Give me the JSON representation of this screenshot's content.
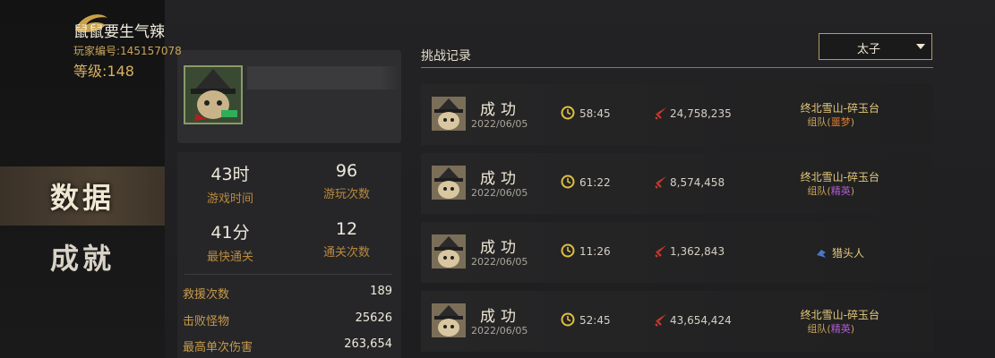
{
  "sidebar": {
    "items": [
      {
        "label": "数据",
        "active": true
      },
      {
        "label": "成就",
        "active": false
      }
    ]
  },
  "player": {
    "name": "鼠鼠要生气辣",
    "id_text": "玩家编号:145157078",
    "level_text": "等级:148"
  },
  "stats": {
    "big": [
      {
        "value": "43时",
        "label": "游戏时间"
      },
      {
        "value": "96",
        "label": "游玩次数"
      },
      {
        "value": "41分",
        "label": "最快通关"
      },
      {
        "value": "12",
        "label": "通关次数"
      }
    ],
    "rows": [
      {
        "label": "救援次数",
        "value": "189"
      },
      {
        "label": "击败怪物",
        "value": "25626"
      },
      {
        "label": "最高单次伤害",
        "value": "263,654"
      }
    ]
  },
  "records": {
    "title": "挑战记录",
    "filter": "太子",
    "items": [
      {
        "result": "成功",
        "date": "2022/06/05",
        "time": "58:45",
        "damage": "24,758,235",
        "location": "终北雪山-碎玉台",
        "team_prefix": "组队(",
        "difficulty": "噩梦",
        "team_suffix": ")",
        "difficulty_color": "#e07a2a"
      },
      {
        "result": "成功",
        "date": "2022/06/05",
        "time": "61:22",
        "damage": "8,574,458",
        "location": "终北雪山-碎玉台",
        "team_prefix": "组队(",
        "difficulty": "精英",
        "team_suffix": ")",
        "difficulty_color": "#b45ad8"
      },
      {
        "result": "成功",
        "date": "2022/06/05",
        "time": "11:26",
        "damage": "1,362,843",
        "solo": "猎头人"
      },
      {
        "result": "成功",
        "date": "2022/06/05",
        "time": "52:45",
        "damage": "43,654,424",
        "location": "终北雪山-碎玉台",
        "team_prefix": "组队(",
        "difficulty": "精英",
        "team_suffix": ")",
        "difficulty_color": "#b45ad8"
      }
    ]
  },
  "colors": {
    "accent_gold": "#c9a45a",
    "orange": "#e07a2a",
    "purple": "#b45ad8"
  },
  "icons": [
    "logo-icon",
    "clock-icon",
    "sword-icon",
    "crow-icon",
    "dropdown-caret-icon"
  ]
}
